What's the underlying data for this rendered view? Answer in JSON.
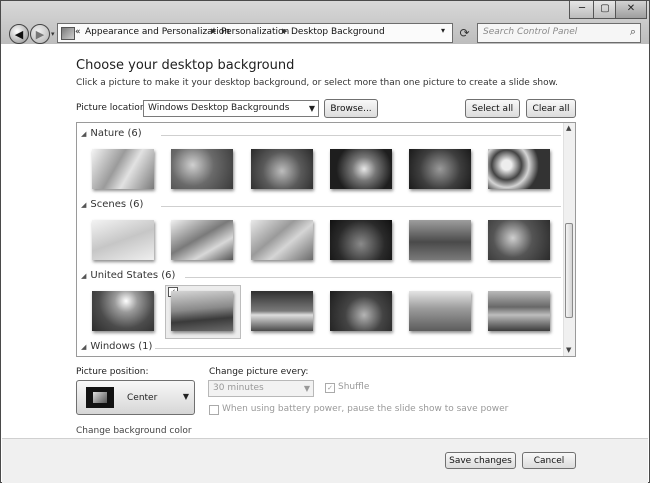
{
  "window": {
    "min_label": "─",
    "max_label": "▢",
    "close_label": "✕"
  },
  "nav": {
    "breadcrumb": [
      "Appearance and Personalization",
      "Personalization",
      "Desktop Background"
    ],
    "overflow_label": "«",
    "search_placeholder": "Search Control Panel"
  },
  "header": {
    "title": "Choose your desktop background",
    "subtitle": "Click a picture to make it your desktop background, or select more than one picture to create a slide show."
  },
  "location": {
    "label": "Picture location:",
    "value": "Windows Desktop Backgrounds",
    "browse_label": "Browse...",
    "select_all_label": "Select all",
    "clear_all_label": "Clear all"
  },
  "gallery": {
    "groups": [
      {
        "name": "Nature (6)"
      },
      {
        "name": "Scenes (6)"
      },
      {
        "name": "United States (6)"
      },
      {
        "name": "Windows (1)"
      }
    ]
  },
  "position": {
    "label": "Picture position:",
    "value": "Center"
  },
  "slideshow": {
    "change_label": "Change picture every:",
    "interval": "30 minutes",
    "shuffle_label": "Shuffle",
    "battery_label": "When using battery power, pause the slide show to save power"
  },
  "bg_color_link": "Change background color",
  "footer": {
    "save_label": "Save changes",
    "cancel_label": "Cancel"
  }
}
